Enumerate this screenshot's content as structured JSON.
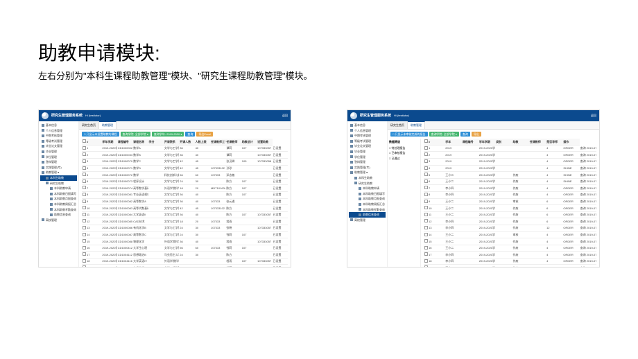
{
  "page": {
    "title": "助教申请模块:",
    "subtitle": "左右分别为\"本科生课程助教管理\"模块、\"研究生课程助教管理\"模块。"
  },
  "common": {
    "app_title": "研究生管理服务系统",
    "greet_prefix": "Hi ",
    "user": "(testtutor)",
    "header_right": "返回",
    "tabs": {
      "home": "研究生首页",
      "ta": "助教管理"
    },
    "side": [
      {
        "label": "基本信息",
        "class": "mi"
      },
      {
        "label": "个人信息管理",
        "class": "mi"
      },
      {
        "label": "中期考核管理",
        "class": "mi"
      },
      {
        "label": "等级考试管理",
        "class": "mi"
      },
      {
        "label": "毕业论文管理",
        "class": "mi"
      },
      {
        "label": "毕业管理",
        "class": "mi"
      },
      {
        "label": "学位管理",
        "class": "mi"
      },
      {
        "label": "答辩管理",
        "class": "mi"
      },
      {
        "label": "实践管理(专)",
        "class": "mi"
      },
      {
        "label": "助教管理 ▾",
        "class": "mi"
      },
      {
        "label": "本科生助教",
        "class": "mi sub",
        "id": "ug"
      },
      {
        "label": "研究生助教",
        "class": "mi sub",
        "id": "pg"
      },
      {
        "label": "本科助教申请",
        "class": "mi sub2"
      },
      {
        "label": "本科助教日报填写",
        "class": "mi sub2"
      },
      {
        "label": "本科助教月报查询",
        "class": "mi sub2"
      },
      {
        "label": "本科助教周报汇总",
        "class": "mi sub2"
      },
      {
        "label": "本科助教考勤查询",
        "class": "mi sub2"
      },
      {
        "label": "助教信息查询",
        "class": "mi sub2",
        "id": "info"
      },
      {
        "label": "离校管理",
        "class": "mi"
      }
    ]
  },
  "left": {
    "active_side": "ug",
    "toolbar": [
      {
        "label": "□ 只显示未设置助教的课程",
        "cls": "blue"
      },
      {
        "label": "查询学院: 全部学院 ▾",
        "cls": "green"
      },
      {
        "label": "查询学年: 2019-2020 ▾",
        "cls": "green"
      },
      {
        "label": "查询",
        "cls": "blue"
      },
      {
        "label": "导出Excel",
        "cls": "orange"
      }
    ],
    "columns": [
      "",
      "#",
      "学年学期",
      "课程编号",
      "课程名称",
      "学分",
      "开课院系",
      "开课人数",
      "人数上限",
      "任课教师工号",
      "任课教师",
      "助教总计",
      "设置助教"
    ],
    "rows": [
      [
        "1",
        "2019-2020学年 春季学期",
        "CD1000002",
        "数学A",
        "",
        "文学与工学管理学院",
        "36",
        "40",
        "",
        "谭莉",
        "107",
        "107333057",
        "已设置"
      ],
      [
        "2",
        "2019-2020学年 春季学期",
        "CD1000033",
        "数学B",
        "",
        "文学与工学管理学院",
        "36",
        "40",
        "",
        "谭莉",
        "",
        "107333057",
        "已设置"
      ],
      [
        "3",
        "2019-2020学年 春季学期",
        "CD1000070",
        "数学C",
        "",
        "文学与工学管理学院",
        "42",
        "45",
        "",
        "张汉卿",
        "105",
        "107333058",
        "已设置"
      ],
      [
        "4",
        "2019-2020学年 春季学期",
        "CD1000071",
        "数学D",
        "",
        "文学与工学管理学院",
        "42",
        "45",
        "107333102",
        "孙珍",
        "",
        "",
        "已设置"
      ],
      [
        "5",
        "2019-2020学年 春季学期",
        "CD1000072",
        "数学",
        "",
        "科技创新与科学",
        "56",
        "60",
        "107333",
        "邓志敏",
        "",
        "",
        "已设置"
      ],
      [
        "6",
        "2019-2020学年 春季学期",
        "CD1000073",
        "程序设计",
        "",
        "文学与工学管理学院",
        "24",
        "30",
        "",
        "陈方",
        "107",
        "",
        "已设置"
      ],
      [
        "7",
        "2019-2020学年 春季学期",
        "CD1000074",
        "高等数学基础",
        "",
        "外语学院科学",
        "18",
        "20",
        "MDT101634",
        "陈方",
        "107",
        "",
        "已设置"
      ],
      [
        "8",
        "2019-2020学年 春季学期",
        "CD1000081",
        "专业英语视听",
        "",
        "文学与工学管理学院",
        "36",
        "40",
        "",
        "陈方",
        "107",
        "",
        "已设置"
      ],
      [
        "9",
        "2019-2020学年 春季学期",
        "CD1000082",
        "高等数学A",
        "",
        "文学与工学管理学院",
        "36",
        "40",
        "107333",
        "张元通",
        "",
        "",
        "已设置"
      ],
      [
        "10",
        "2019-2020学年 春季学期",
        "CD1000083",
        "高等代数基础",
        "",
        "文学与工学管理学院",
        "42",
        "45",
        "107333102",
        "陈方",
        "",
        "",
        "已设置"
      ],
      [
        "11",
        "2019-2020学年 春季学期",
        "CD1000084",
        "大学英语II",
        "",
        "文学与工学管理学院",
        "36",
        "40",
        "",
        "陈方",
        "107",
        "107333057",
        "已设置"
      ],
      [
        "12",
        "2019-2020学年 春季学期",
        "CD1000085",
        "CAD技术",
        "",
        "文学与工学管理学院",
        "18",
        "20",
        "107333",
        "程雨",
        "",
        "",
        "已设置"
      ],
      [
        "13",
        "2019-2020学年 春季学期",
        "CD1000086",
        "有机化学B",
        "",
        "文学与工学管理学院",
        "24",
        "30",
        "107333",
        "张晓",
        "",
        "107333057",
        "已设置"
      ],
      [
        "14",
        "2019-2020学年 春季学期",
        "CD1000087",
        "高等数学C",
        "",
        "文学与工学管理学院",
        "24",
        "30",
        "",
        "钱莉",
        "107",
        "",
        "已设置"
      ],
      [
        "15",
        "2019-2020学年 春季学期",
        "CD1000088",
        "物理化学",
        "",
        "外语学院科学",
        "36",
        "40",
        "",
        "程雨",
        "",
        "107333057",
        "已设置"
      ],
      [
        "16",
        "2019-2020学年 春季学期",
        "CD1000412",
        "大学生心理",
        "",
        "文学与工学管理学院",
        "56",
        "60",
        "107333",
        "钱莉",
        "107",
        "",
        "已设置"
      ],
      [
        "17",
        "2019-2020学年 春季学期",
        "CD1004112",
        "思想政治B",
        "",
        "马克思主义学院",
        "24",
        "30",
        "",
        "陈方",
        "",
        "",
        "已设置"
      ],
      [
        "18",
        "2019-2020学年 春季学期",
        "CD1004116",
        "大学英语IV",
        "",
        "外语学院科学",
        "",
        "",
        "",
        "程雨",
        "107",
        "107333057",
        "已设置"
      ],
      [
        "19",
        "2019-2020学年 春季学期",
        "CD1004117",
        "有机化学",
        "",
        "化学工程学院",
        "",
        "",
        "107333",
        "钱莉",
        "",
        "",
        "已设置"
      ],
      [
        "20",
        "2019-2020学年 春季学期",
        "CD1004130",
        "思想政治",
        "",
        "马克思主义学院",
        "",
        "",
        "",
        "张晓",
        "107",
        "",
        "已设置"
      ],
      [
        "21",
        "2019-2020学年 春季学期",
        "CD1004355",
        "高等数学",
        "",
        "数学与统计学院",
        "",
        "",
        "",
        "谭莉",
        "",
        "",
        "已设置"
      ],
      [
        "22",
        "2019-2020学年 春季学期",
        "CIN250101B",
        "数学B",
        "",
        "数学与统计学院",
        "",
        "",
        "",
        "张汉卿",
        "",
        "",
        "已设置"
      ],
      [
        "23",
        "2019-2020学年 春季学期",
        "CIN250101B",
        "数学B",
        "",
        "数学与统计学院",
        "",
        "",
        "",
        "孙珍",
        "",
        "",
        "已设置"
      ]
    ]
  },
  "right": {
    "active_side": "info",
    "toolbar": [
      {
        "label": "□ 只显示未审核完成的报告",
        "cls": "blue"
      },
      {
        "label": "查询学院: 全部学院 ▾",
        "cls": "green"
      },
      {
        "label": "查询",
        "cls": "blue"
      },
      {
        "label": "导出",
        "cls": "orange"
      }
    ],
    "left_panel": {
      "title": "数据筛选",
      "items": [
        "□ 待处理报告",
        "□ 已审核报告",
        "□ 已通过"
      ]
    },
    "columns": [
      "",
      "#",
      "学年",
      "课程编号",
      "学年学期",
      "类别",
      "助教",
      "任课教师",
      "是否导师",
      "操作"
    ],
    "rows": [
      [
        "1",
        "2019",
        "",
        "2019-2020学年",
        "",
        "",
        "",
        "4",
        "ORDER",
        "查询 2019-07-17 16:07"
      ],
      [
        "2",
        "2019",
        "",
        "2019-2020学年",
        "",
        "",
        "",
        "4",
        "ORDER",
        "查询 2019-07-17 16:07"
      ],
      [
        "3",
        "2019",
        "",
        "2019-2020学年",
        "",
        "",
        "",
        "4",
        "ORDER",
        "查询 2019-07-17 16:07"
      ],
      [
        "4",
        "2019",
        "",
        "2019-2020学年",
        "",
        "",
        "",
        "4",
        "SHINE",
        "查询 2019-07-17 16:07"
      ],
      [
        "5",
        "王小二",
        "",
        "2019-2020学年",
        "",
        "作废",
        "",
        "4",
        "SHINE",
        "查询 2019-07-17 16:07"
      ],
      [
        "6",
        "王小二",
        "",
        "2019-2020学年",
        "",
        "作废",
        "",
        "4",
        "SHINE",
        "查询 2019-07-17 16:07"
      ],
      [
        "7",
        "李小四",
        "",
        "2019-2020学年",
        "",
        "作废",
        "",
        "4",
        "ORDER",
        "查询 2019-07-17 16:07"
      ],
      [
        "8",
        "李小四",
        "",
        "2019-2020学年",
        "",
        "作废",
        "",
        "4",
        "ORDER",
        "查询 2019-07-17 16:07"
      ],
      [
        "9",
        "王小二",
        "",
        "2019-2020学年",
        "",
        "审核",
        "",
        "6",
        "ORDER",
        "查询 2019-07-17 16:07"
      ],
      [
        "10",
        "王小二",
        "",
        "2019-2020学年",
        "",
        "作废",
        "",
        "6",
        "ORDER",
        "查询 2019-07-17 16:07"
      ],
      [
        "11",
        "王小二",
        "",
        "2019-2020学年",
        "",
        "作废",
        "",
        "6",
        "ORDER",
        "查询 2019-07-17 16:07"
      ],
      [
        "12",
        "李小四",
        "",
        "2019-2020学年",
        "",
        "作废",
        "",
        "6",
        "ORDER",
        "查询 2019-07-17 16:07"
      ],
      [
        "13",
        "李小四",
        "",
        "2019-2020学年",
        "",
        "作废",
        "",
        "12",
        "ORDER",
        "查询 2019-07-17 16:07"
      ],
      [
        "14",
        "王小二",
        "",
        "2019-2020学年",
        "",
        "审核",
        "",
        "4",
        "ORDER",
        "查询 2019-07-17 16:07"
      ],
      [
        "15",
        "王小二",
        "",
        "2019-2020学年",
        "",
        "作废",
        "",
        "4",
        "ORDER",
        "查询 2019-07-17 16:07"
      ],
      [
        "16",
        "王小二",
        "",
        "2019-2020学年",
        "",
        "作废",
        "",
        "4",
        "ORDER",
        "查询 2019-07-17 16:07"
      ],
      [
        "17",
        "李小四",
        "",
        "2019-2020学年",
        "",
        "作废",
        "",
        "4",
        "ORDER",
        "查询 2019-07-17 16:07"
      ],
      [
        "18",
        "李小四",
        "",
        "2019-2020学年",
        "",
        "作废",
        "",
        "4",
        "ORDER",
        "查询 2019-07-17 16:07"
      ],
      [
        "19",
        "王小二",
        "",
        "2019-2020学年",
        "",
        "作废",
        "",
        "4",
        "ORDER",
        "查询 2019-07-17 16:07"
      ],
      [
        "20",
        "王小二",
        "",
        "2019-2020学年",
        "",
        "审核",
        "",
        "4",
        "ORDER",
        "查询 2019-07-17 16:07"
      ],
      [
        "21",
        "王小二",
        "",
        "2019-2020学年",
        "",
        "作废",
        "",
        "6",
        "ORDER",
        "查询 2019-07-17 16:07"
      ],
      [
        "22",
        "李小四",
        "",
        "2019-2020学年",
        "",
        "审核",
        "",
        "6",
        "ORDER",
        "查询 2019-07-17 16:07"
      ],
      [
        "23",
        "李小四",
        "",
        "2019-2020学年",
        "",
        "作废",
        "",
        "6",
        "ORDER",
        "查询 2019-07-17 16:07"
      ]
    ]
  }
}
